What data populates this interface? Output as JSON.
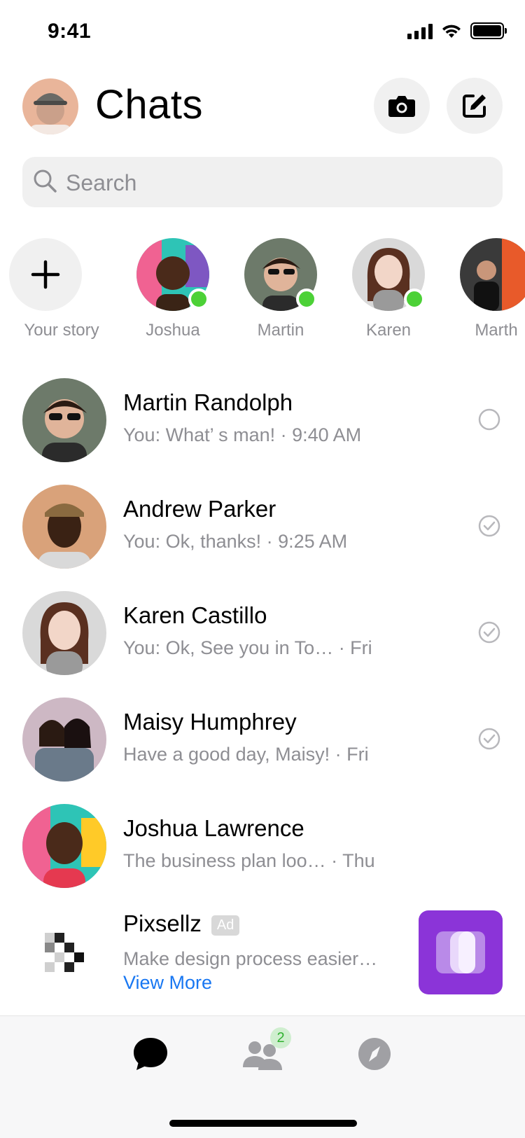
{
  "status_bar": {
    "time": "9:41"
  },
  "header": {
    "title": "Chats"
  },
  "search": {
    "placeholder": "Search"
  },
  "stories": [
    {
      "name": "Your story"
    },
    {
      "name": "Joshua",
      "online": true
    },
    {
      "name": "Martin",
      "online": true
    },
    {
      "name": "Karen",
      "online": true
    },
    {
      "name": "Marth"
    }
  ],
  "chats": [
    {
      "name": "Martin Randolph",
      "preview": "You: What’ s man! · 9:40 AM",
      "status": "sent"
    },
    {
      "name": "Andrew Parker",
      "preview": "You: Ok, thanks! · 9:25 AM",
      "status": "delivered"
    },
    {
      "name": "Karen Castillo",
      "preview": "You: Ok, See you in To… · Fri",
      "status": "delivered"
    },
    {
      "name": "Maisy Humphrey",
      "preview": "Have a good day, Maisy! · Fri",
      "status": "delivered"
    },
    {
      "name": "Joshua Lawrence",
      "preview": "The business plan loo…  · Thu",
      "status": "none"
    }
  ],
  "ad": {
    "name": "Pixsellz",
    "tag": "Ad",
    "preview": "Make design process easier…",
    "cta": "View More",
    "thumb_color": "#8b34d8"
  },
  "tabbar": {
    "tabs": [
      {
        "icon": "chat-bubble-icon",
        "active": true
      },
      {
        "icon": "people-icon",
        "badge": "2"
      },
      {
        "icon": "compass-icon"
      }
    ]
  },
  "colors": {
    "online": "#4cd137",
    "link": "#1877f2",
    "secondary_text": "#8e8e93"
  }
}
